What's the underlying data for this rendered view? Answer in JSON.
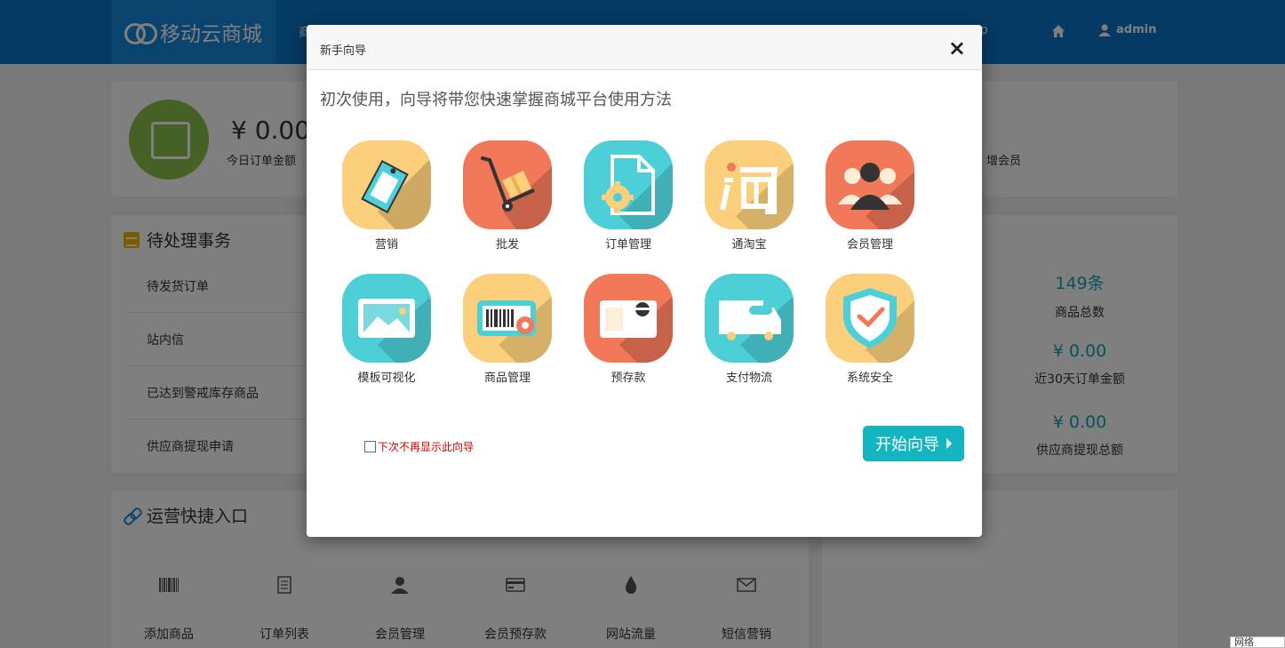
{
  "header": {
    "logo_text": "移动云商城",
    "nav_left_peek": "商",
    "nav_right_peek": "p",
    "username": "admin"
  },
  "stats": {
    "today_amount": "¥ 0.00",
    "today_label": "今日订单金额",
    "right_label": "增会员"
  },
  "todo": {
    "title": "待处理事务",
    "items": [
      "待发货订单",
      "站内信",
      "已达到警戒库存商品",
      "供应商提现申请"
    ]
  },
  "right_stats": {
    "items": [
      {
        "value": "149条",
        "label": "商品总数"
      },
      {
        "value": "¥ 0.00",
        "label": "近30天订单金额"
      },
      {
        "value": "¥ 0.00",
        "label": "供应商提现总额"
      }
    ]
  },
  "shortcuts": {
    "title": "运营快捷入口",
    "items": [
      {
        "label": "添加商品",
        "icon": "barcode-icon"
      },
      {
        "label": "订单列表",
        "icon": "list-icon"
      },
      {
        "label": "会员管理",
        "icon": "person-icon"
      },
      {
        "label": "会员预存款",
        "icon": "card-icon"
      },
      {
        "label": "网站流量",
        "icon": "drop-icon"
      },
      {
        "label": "短信营销",
        "icon": "envelope-icon"
      }
    ]
  },
  "net_tag": "网络",
  "modal": {
    "title": "新手向导",
    "close": "×",
    "intro": "初次使用，向导将带您快速掌握商城平台使用方法",
    "tiles_row1": [
      {
        "label": "营销",
        "icon": "price-tag-icon",
        "color": "#fbcf7b"
      },
      {
        "label": "批发",
        "icon": "hand-truck-icon",
        "color": "#f2785a"
      },
      {
        "label": "订单管理",
        "icon": "document-gear-icon",
        "color": "#4ccfd6"
      },
      {
        "label": "通淘宝",
        "icon": "taobao-icon",
        "color": "#fbcf7b"
      },
      {
        "label": "会员管理",
        "icon": "members-icon",
        "color": "#f2785a"
      }
    ],
    "tiles_row2": [
      {
        "label": "模板可视化",
        "icon": "picture-icon",
        "color": "#4ccfd6"
      },
      {
        "label": "商品管理",
        "icon": "barcode-gear-icon",
        "color": "#fbcf7b"
      },
      {
        "label": "预存款",
        "icon": "money-box-icon",
        "color": "#f2785a"
      },
      {
        "label": "支付物流",
        "icon": "truck-icon",
        "color": "#4ccfd6"
      },
      {
        "label": "系统安全",
        "icon": "shield-icon",
        "color": "#fbcf7b"
      }
    ],
    "dont_show_label": "下次不再显示此向导",
    "start_button": "开始向导"
  }
}
